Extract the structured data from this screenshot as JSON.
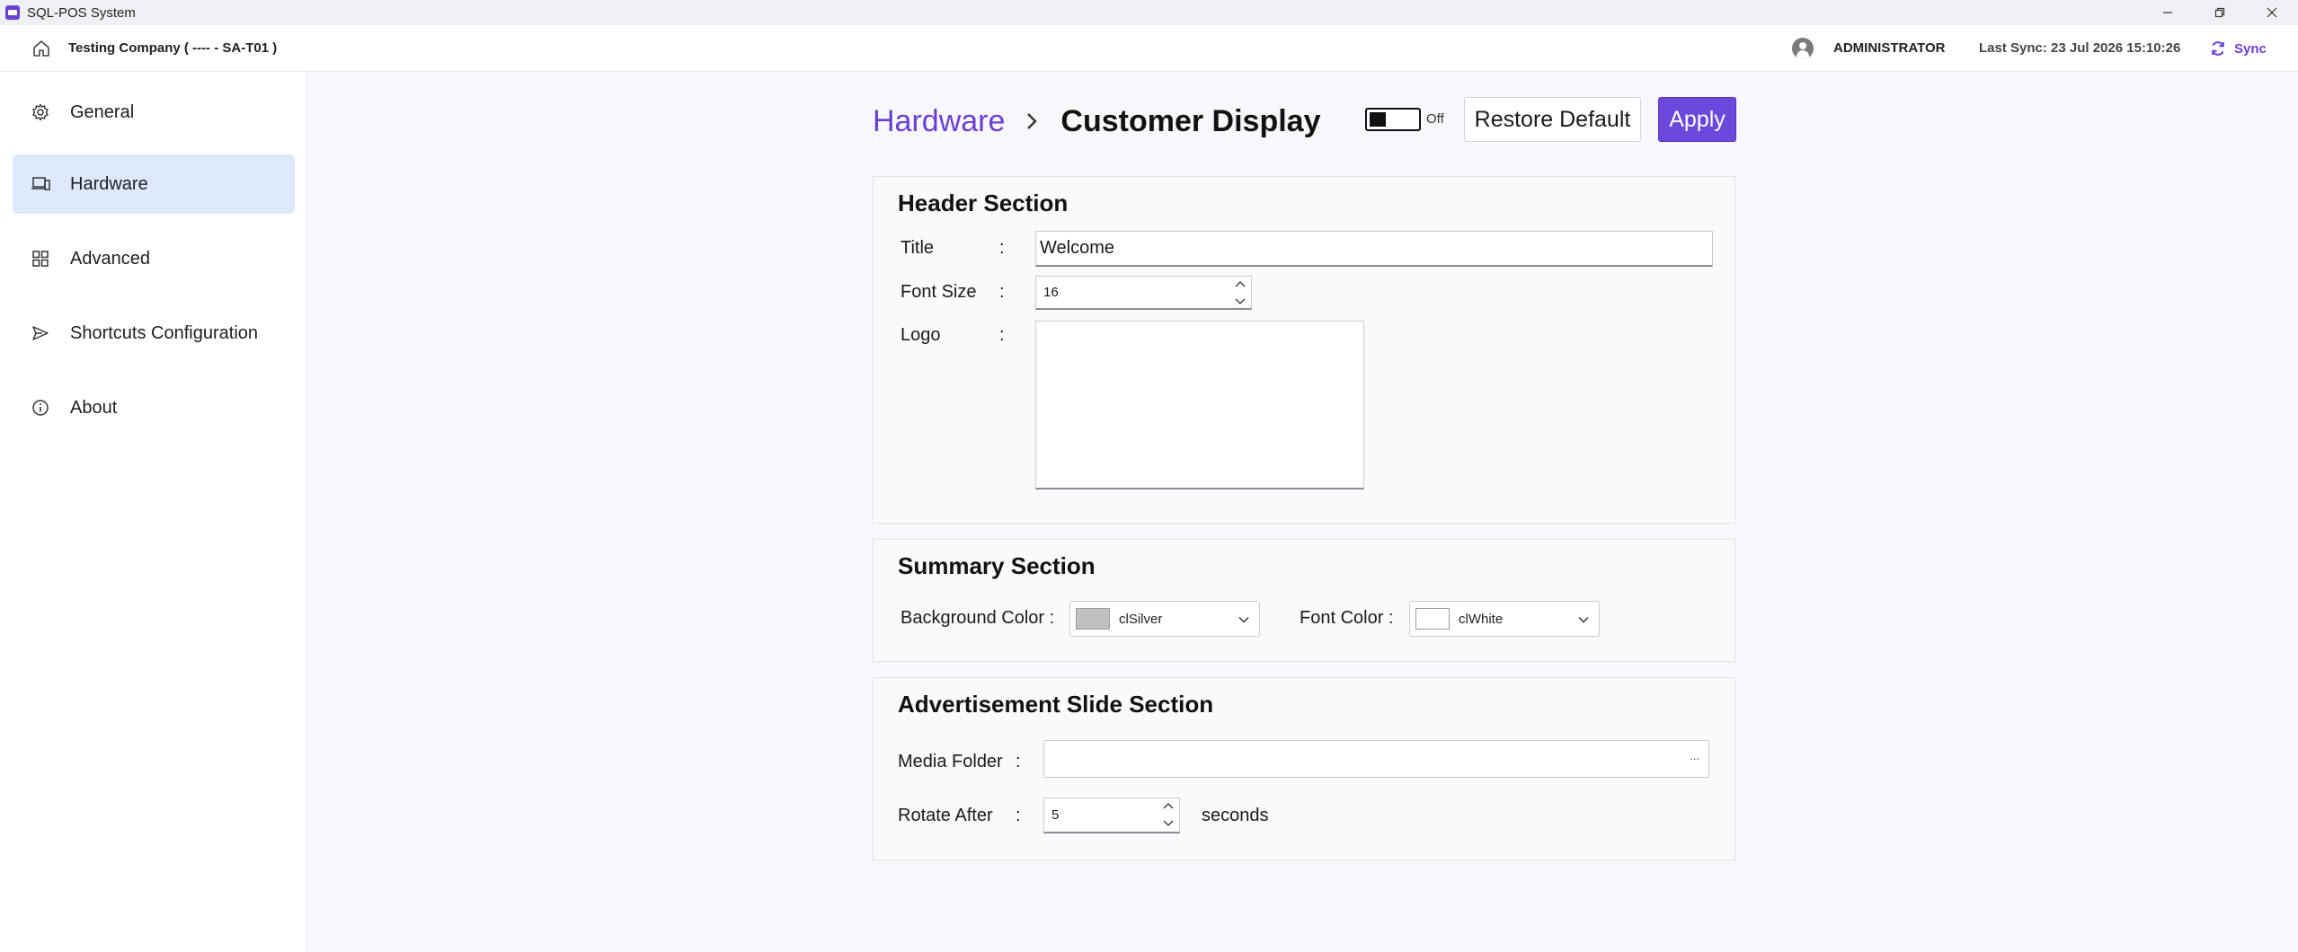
{
  "window": {
    "title": "SQL-POS System",
    "controls": {
      "minimize": "—",
      "restore": "❐",
      "close": "✕"
    }
  },
  "header": {
    "company": "Testing Company ( ---- - SA-T01 )",
    "user": "ADMINISTRATOR",
    "last_sync": "Last Sync: 23 Jul 2026 15:10:26",
    "sync_label": "Sync"
  },
  "sidebar": {
    "items": [
      {
        "label": "General",
        "icon": "gear-icon",
        "active": false
      },
      {
        "label": "Hardware",
        "icon": "devices-icon",
        "active": true
      },
      {
        "label": "Advanced",
        "icon": "grid-icon",
        "active": false
      },
      {
        "label": "Shortcuts Configuration",
        "icon": "send-icon",
        "active": false
      },
      {
        "label": "About",
        "icon": "info-icon",
        "active": false
      }
    ]
  },
  "breadcrumb": {
    "parent": "Hardware",
    "current": "Customer Display"
  },
  "toolbar": {
    "toggle_label": "Off",
    "toggle_on": false,
    "restore_label": "Restore Default",
    "apply_label": "Apply"
  },
  "header_section": {
    "title": "Header Section",
    "title_label": "Title",
    "title_value": "Welcome",
    "font_size_label": "Font Size",
    "font_size_value": "16",
    "logo_label": "Logo",
    "colon": ":"
  },
  "summary_section": {
    "title": "Summary Section",
    "bg_label": "Background Color :",
    "bg_value": "clSilver",
    "bg_swatch": "#c0c0c0",
    "font_label": "Font Color :",
    "font_value": "clWhite",
    "font_swatch": "#ffffff"
  },
  "ad_section": {
    "title": "Advertisement Slide Section",
    "media_label": "Media Folder",
    "media_value": "",
    "browse_label": "...",
    "rotate_label": "Rotate After",
    "rotate_value": "5",
    "rotate_unit": "seconds",
    "colon": ":"
  },
  "colors": {
    "accent": "#6b3fd4",
    "active_nav": "#dde8fb"
  }
}
